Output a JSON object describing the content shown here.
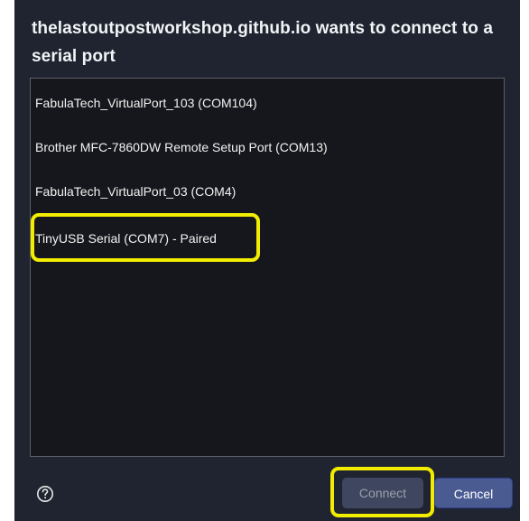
{
  "dialog": {
    "title": "thelastoutpostworkshop.github.io wants to connect to a serial port"
  },
  "ports": [
    {
      "label": "FabulaTech_VirtualPort_103 (COM104)"
    },
    {
      "label": "Brother MFC-7860DW Remote Setup Port (COM13)"
    },
    {
      "label": "FabulaTech_VirtualPort_03 (COM4)"
    },
    {
      "label": "TinyUSB Serial (COM7) - Paired"
    }
  ],
  "footer": {
    "help_icon": "question-circle-icon",
    "connect_label": "Connect",
    "cancel_label": "Cancel"
  },
  "colors": {
    "dialog_bg": "#1f2430",
    "list_bg": "#15171c",
    "highlight": "#f2ec00",
    "connect_bg": "#3f4760",
    "cancel_bg": "#4a5b92"
  }
}
